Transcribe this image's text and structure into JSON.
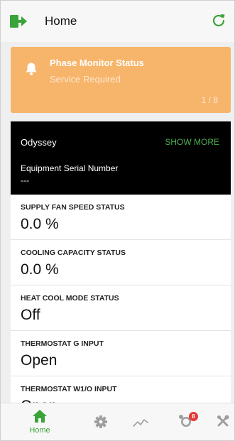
{
  "header": {
    "title": "Home",
    "logout_icon": "logout-icon",
    "refresh_icon": "refresh-icon"
  },
  "alert": {
    "title": "Phase Monitor Status",
    "subtitle": "Service Required",
    "pager": "1 / 8",
    "icon": "bell-icon",
    "color": "#f7b56b"
  },
  "device": {
    "name": "Odyssey",
    "show_more": "SHOW MORE",
    "serial_label": "Equipment Serial Number",
    "serial_value": "---"
  },
  "statuses": [
    {
      "label": "SUPPLY FAN SPEED STATUS",
      "value": "0.0 %"
    },
    {
      "label": "COOLING CAPACITY STATUS",
      "value": "0.0 %"
    },
    {
      "label": "HEAT COOL MODE STATUS",
      "value": "Off"
    },
    {
      "label": "THERMOSTAT G INPUT",
      "value": "Open"
    },
    {
      "label": "THERMOSTAT W1/O INPUT",
      "value": "Open"
    }
  ],
  "nav": {
    "home_label": "Home",
    "alarm_badge": "8",
    "accent": "#3aa43a",
    "icons": [
      "home-icon",
      "gear-icon",
      "trend-icon",
      "alarm-icon",
      "tools-icon"
    ]
  }
}
